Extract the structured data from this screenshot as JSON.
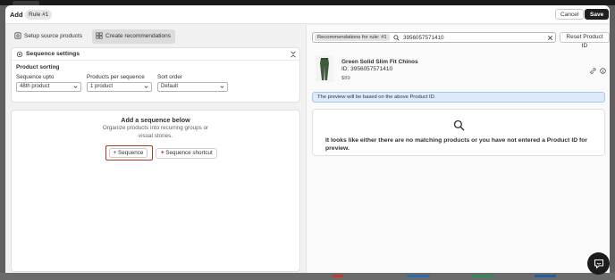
{
  "header": {
    "title": "Add",
    "rule_badge": "Rule #1",
    "cancel_label": "Cancel",
    "save_label": "Save"
  },
  "tabs": [
    {
      "label": "Setup source products",
      "icon": "target-icon",
      "active": false
    },
    {
      "label": "Create recommendations",
      "icon": "grid-icon",
      "active": true
    }
  ],
  "sequence_settings": {
    "title": "Sequence settings",
    "product_sorting_label": "Product sorting",
    "fields": [
      {
        "label": "Sequence upto",
        "value": "48th product"
      },
      {
        "label": "Products per sequence",
        "value": "1 product"
      },
      {
        "label": "Sort order",
        "value": "Default"
      }
    ]
  },
  "sequence_area": {
    "heading": "Add a sequence below",
    "description": "Organize products into recurring groups or visual stories.",
    "add_sequence_label": "Sequence",
    "shortcut_label": "Sequence shortcut"
  },
  "preview_panel": {
    "rule_tag": "Recommendations for rule: #1",
    "search_value": "3956057571410",
    "reset_label": "Reset Product ID",
    "product": {
      "name": "Green Solid Slim Fit Chinos",
      "id_text": "ID: 3956057571410",
      "price": "$89"
    },
    "info_text": "The preview will be based on the above Product ID.",
    "empty_message": "It looks like either there are no matching products or you have not entered a Product ID for preview."
  },
  "colors": {
    "primary_button": "#1f1f1f",
    "highlight_border": "#b13a20",
    "info_bg": "#dceafc",
    "active_tab_bg": "#dcdcdc"
  }
}
